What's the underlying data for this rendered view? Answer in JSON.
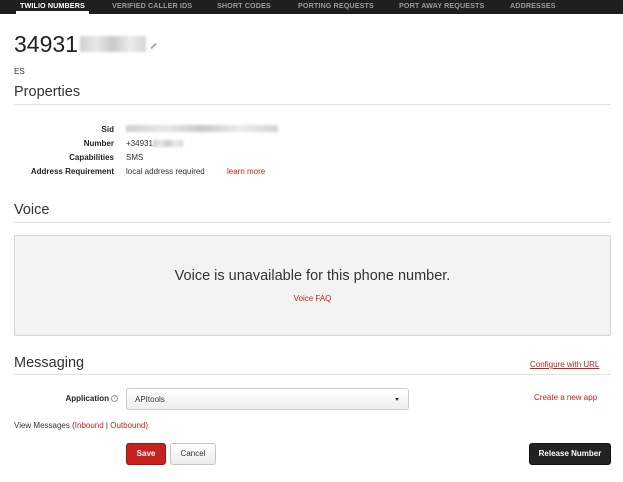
{
  "nav": {
    "tabs": [
      {
        "label": "TWILIO NUMBERS",
        "active": true
      },
      {
        "label": "VERIFIED CALLER IDS",
        "active": false
      },
      {
        "label": "SHORT CODES",
        "active": false
      },
      {
        "label": "PORTING REQUESTS",
        "active": false
      },
      {
        "label": "PORT AWAY REQUESTS",
        "active": false
      },
      {
        "label": "ADDRESSES",
        "active": false
      }
    ]
  },
  "header": {
    "phone_number_visible": "34931",
    "country": "ES"
  },
  "properties": {
    "title": "Properties",
    "rows": [
      {
        "label": "Sid",
        "value": ""
      },
      {
        "label": "Number",
        "value": "+34931"
      },
      {
        "label": "Capabilities",
        "value": "SMS"
      },
      {
        "label": "Address Requirement",
        "value": "local address required",
        "link": "learn more"
      }
    ]
  },
  "voice": {
    "title": "Voice",
    "message": "Voice is unavailable for this phone number.",
    "faq_link": "Voice FAQ"
  },
  "messaging": {
    "title": "Messaging",
    "configure_link": "Configure with URL",
    "application_label": "Application",
    "application_value": "APItools",
    "create_app_link": "Create a new app",
    "view_messages_prefix": "View Messages (",
    "inbound_link": "Inbound",
    "separator": " | ",
    "outbound_link": "Outbound",
    "view_messages_suffix": ")"
  },
  "actions": {
    "save": "Save",
    "cancel": "Cancel",
    "release": "Release Number"
  },
  "colors": {
    "accent": "#c4211f",
    "nav_bg": "#1f1f1f"
  }
}
